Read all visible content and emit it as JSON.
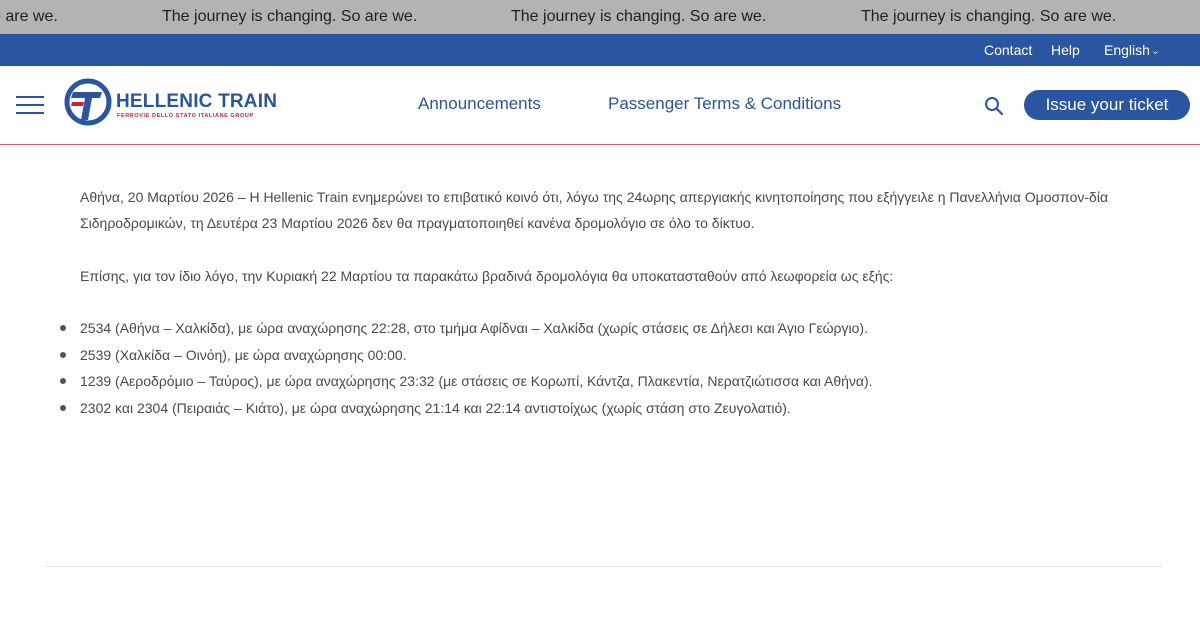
{
  "ticker": {
    "items": [
      "o are we.",
      "The journey is changing. So are we.",
      "The journey is changing. So are we.",
      "The journey is changing. So are we."
    ]
  },
  "utility": {
    "contact": "Contact",
    "help": "Help",
    "language": "English",
    "language_chevron": "›"
  },
  "header": {
    "brand_title": "HELLENIC TRAIN",
    "brand_subtitle": "FERROVIE DELLO STATO ITALIANE GROUP",
    "nav": [
      "Announcements",
      "Passenger Terms & Conditions"
    ],
    "cta": "Issue your ticket",
    "colors": {
      "brand_blue": "#2a55a0",
      "brand_red": "#d21f2f"
    }
  },
  "article": {
    "paragraph1": "Αθήνα, 20 Μαρτίου 2026 – Η Hellenic Train ενημερώνει το επιβατικό κοινό ότι, λόγω της 24ωρης απεργιακής κινητοποίησης που εξήγγειλε η Πανελλήνια Ομοσπον-δία Σιδηροδρομικών, τη Δευτέρα 23 Μαρτίου 2026 δεν θα πραγματοποιηθεί κανένα δρομολόγιο σε όλο το δίκτυο.",
    "paragraph2": "Επίσης, για τον ίδιο λόγο, την Κυριακή 22 Μαρτίου τα παρακάτω βραδινά δρομολόγια θα υποκατασταθούν από λεωφορεία ως εξής:",
    "items": [
      "2534 (Αθήνα – Χαλκίδα), με ώρα αναχώρησης 22:28, στο τμήμα Αφίδναι – Χαλκίδα (χωρίς στάσεις σε Δήλεσι και Άγιο Γεώργιο).",
      "2539 (Χαλκίδα – Οινόη), με ώρα αναχώρησης 00:00.",
      "1239 (Αεροδρόμιο – Ταύρος), με ώρα αναχώρησης 23:32 (με στάσεις σε Κορωπί, Κάντζα, Πλακεντία, Νερατζιώτισσα και Αθήνα).",
      "2302 και 2304 (Πειραιάς – Κιάτο), με ώρα αναχώρησης 21:14 και 22:14 αντιστοίχως (χωρίς στάση στο Ζευγολατιό)."
    ]
  }
}
